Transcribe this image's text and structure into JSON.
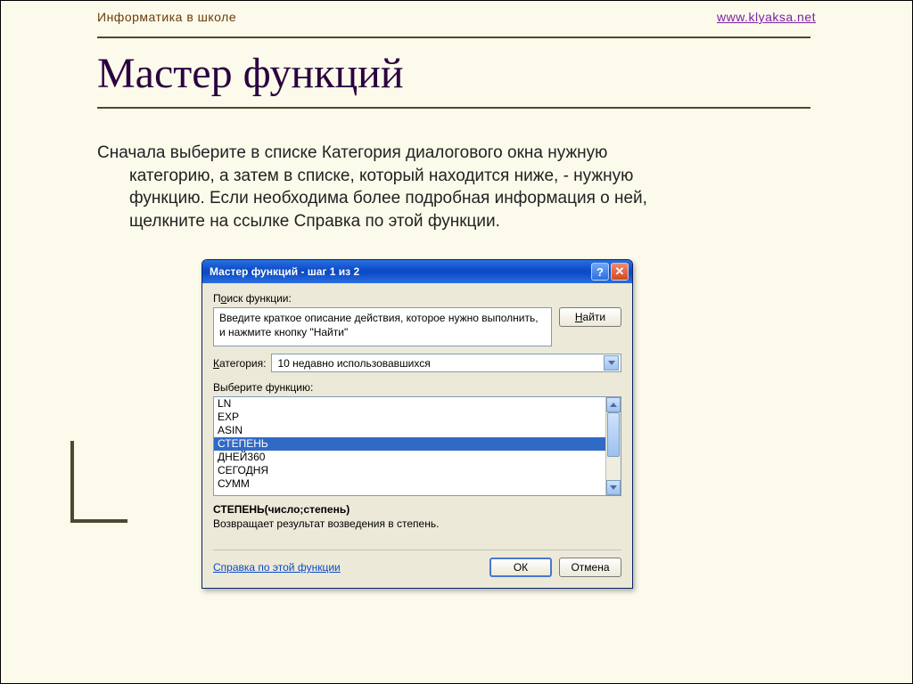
{
  "header": {
    "left": "Информатика в школе",
    "link": "www.klyaksa.net"
  },
  "title": "Мастер функций",
  "body": {
    "line1": "Сначала выберите в списке Категория диалогового окна нужную",
    "line2": "категорию, а затем в списке, который находится ниже, - нужную",
    "line3": "функцию. Если необходима более подробная информация о ней,",
    "line4": "щелкните на ссылке Справка по этой функции."
  },
  "dialog": {
    "title": "Мастер функций - шаг 1 из 2",
    "search_label_pre": "П",
    "search_label_u": "о",
    "search_label_post": "иск функции:",
    "search_text": "Введите краткое описание действия, которое нужно выполнить, и нажмите кнопку \"Найти\"",
    "find_u": "Н",
    "find_rest": "айти",
    "cat_label_u": "К",
    "cat_label_rest": "атегория:",
    "category_value": "10 недавно использовавшихся",
    "select_function_label": "Выберите функцию:",
    "functions": [
      "LN",
      "EXP",
      "ASIN",
      "СТЕПЕНЬ",
      "ДНЕЙ360",
      "СЕГОДНЯ",
      "СУММ"
    ],
    "selected_function_index": 3,
    "signature": "СТЕПЕНЬ(число;степень)",
    "description": "Возвращает результат возведения в степень.",
    "help_link": "Справка по этой функции",
    "ok": "ОК",
    "cancel": "Отмена"
  }
}
